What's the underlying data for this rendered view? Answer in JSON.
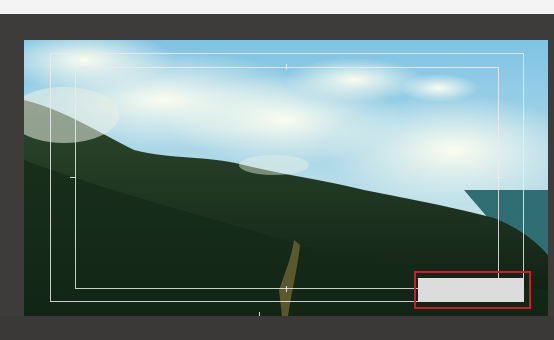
{
  "viewer": {
    "name": "video-preview",
    "overlays": [
      "action-safe-guide",
      "title-safe-guide"
    ],
    "highlight": {
      "label": "",
      "color": "#d11b2a"
    }
  },
  "scene": {
    "description_icon": "landscape-image-icon",
    "sky_color": "#8fcbe6",
    "forest_color": "#1f3b22"
  }
}
